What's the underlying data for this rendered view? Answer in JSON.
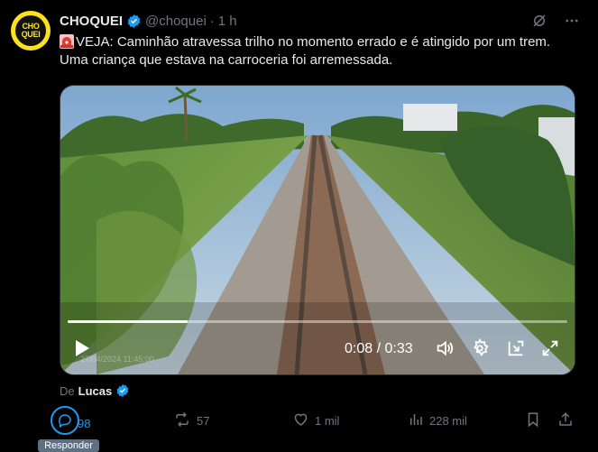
{
  "account": {
    "avatar_text_1": "CHO",
    "avatar_text_2": "QUEI",
    "name": "CHOQUEI",
    "handle": "@choquei",
    "separator": "·",
    "time": "1 h"
  },
  "tweet": {
    "text": "VEJA: Caminhão atravessa trilho no momento errado e é atingido por um trem. Uma criança que estava na carroceria foi arremessada.",
    "emoji": "rotating-light-icon"
  },
  "video": {
    "current_time": "0:08",
    "duration": "0:33",
    "time_display": "0:08 / 0:33",
    "progress_fraction": 0.24,
    "watermark": "27/04/2024 11:45:00"
  },
  "credit": {
    "prefix": "De",
    "author": "Lucas"
  },
  "actions": {
    "replies": "98",
    "retweets": "57",
    "likes": "1 mil",
    "views": "228 mil"
  },
  "tooltip": {
    "label": "Responder"
  },
  "colors": {
    "background": "#000000",
    "text": "#e7e9ea",
    "muted": "#71767b",
    "accent": "#1d9bf0",
    "avatar": "#fbe21a"
  }
}
